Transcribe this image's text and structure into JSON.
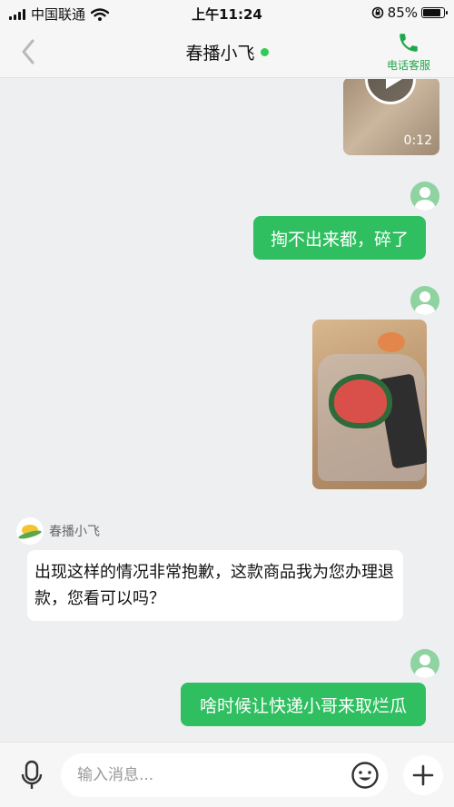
{
  "status_bar": {
    "carrier": "中国联通",
    "time": "上午11:24",
    "battery": "85%",
    "battery_level": 0.85,
    "icons": [
      "signal-icon",
      "wifi-icon",
      "rotation-lock-icon",
      "battery-icon"
    ]
  },
  "header": {
    "title": "春播小飞",
    "online": true,
    "phone_label": "电话客服",
    "icons": [
      "back-chevron-icon",
      "phone-icon"
    ]
  },
  "messages": [
    {
      "type": "video",
      "side": "right",
      "duration": "0:12"
    },
    {
      "type": "text",
      "side": "right",
      "text": "掏不出来都，碎了"
    },
    {
      "type": "image",
      "side": "right"
    },
    {
      "type": "text",
      "side": "left",
      "sender": "春播小飞",
      "text": "出现这样的情况非常抱歉，这款商品我为您办理退款，您看可以吗？"
    },
    {
      "type": "text",
      "side": "right",
      "text": "啥时候让快递小哥来取烂瓜"
    }
  ],
  "input_bar": {
    "placeholder": "输入消息...",
    "icons": [
      "microphone-icon",
      "emoji-icon",
      "plus-icon"
    ]
  },
  "colors": {
    "accent_green": "#2fbf60",
    "online_dot": "#2ecc52",
    "background": "#eeeff1"
  }
}
